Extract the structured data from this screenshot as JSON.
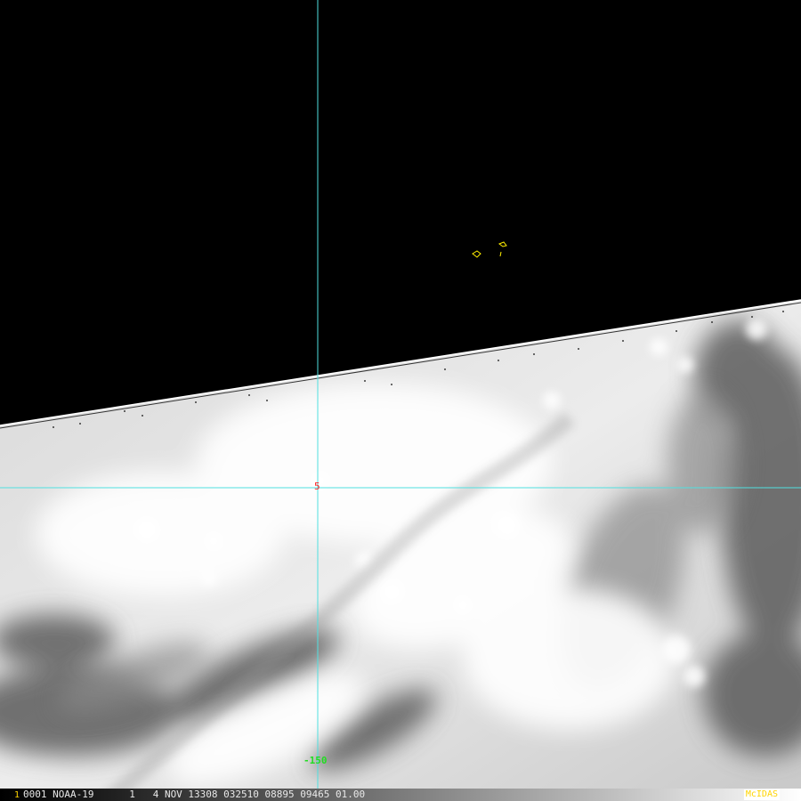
{
  "image": {
    "description_type": "satellite-infrared",
    "background_color": "#000000",
    "cloud_color": "#e6e6e6",
    "grid_color": "#4fe0e0"
  },
  "overlay": {
    "lat_label": "5",
    "lon_label": "-150",
    "lat_label_color": "#ff2020",
    "lon_label_color": "#22dd22"
  },
  "status_bar": {
    "frame_number": "1",
    "info_text": "0001 NOAA-19      1   4 NOV 13308 032510 08895 09465 01.00",
    "brand": "McIDAS"
  }
}
